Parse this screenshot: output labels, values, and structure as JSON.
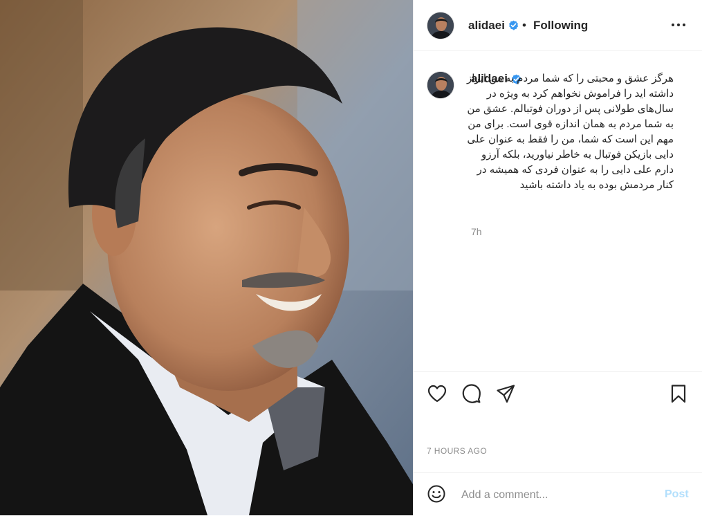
{
  "header": {
    "username": "alidaei",
    "separator": "•",
    "follow_status": "Following"
  },
  "caption": {
    "username": "alidaei",
    "text": "هرگز عشق و محبتی را که شما مردم به من ابراز داشته اید را فراموش نخواهم کرد به ویژه در سال‌های طولانی پس از دوران فوتبالم. عشق من به شما مردم به همان اندازه قوی است. برای من مهم این است که شما، من را فقط به عنوان علی دایی بازیکن فوتبال به خاطر نیاورید، بلکه آرزو دارم علی دایی را به عنوان فردی که همیشه در کنار مردمش بوده به یاد داشته باشید",
    "time_ago": "7h"
  },
  "actions": {
    "like_icon": "heart-icon",
    "comment_icon": "comment-icon",
    "share_icon": "paper-plane-icon",
    "save_icon": "bookmark-icon"
  },
  "timestamp": "7 HOURS AGO",
  "comment_box": {
    "placeholder": "Add a comment...",
    "post_label": "Post"
  },
  "colors": {
    "verified_badge": "#3897f0",
    "post_button_disabled": "#b2dffc",
    "secondary_text": "#8e8e8e"
  }
}
